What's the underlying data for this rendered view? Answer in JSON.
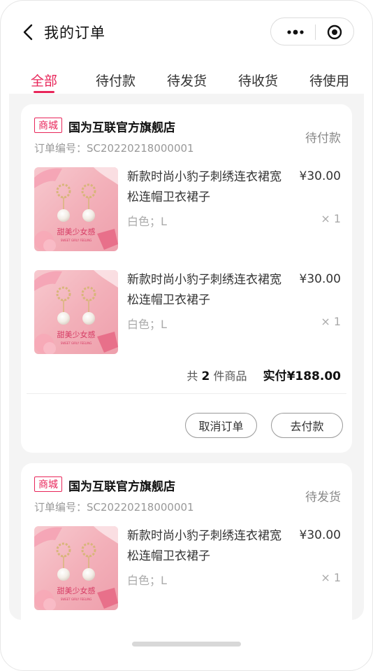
{
  "header": {
    "title": "我的订单"
  },
  "tabs": [
    "全部",
    "待付款",
    "待发货",
    "待收货",
    "待使用"
  ],
  "colors": {
    "accent": "#e8265a"
  },
  "icons": {
    "back": "back-icon",
    "more": "more-icon",
    "close": "target-icon"
  },
  "orders": [
    {
      "tag": "商城",
      "shop": "国为互联官方旗舰店",
      "status": "待付款",
      "order_no": "订单编号：SC20220218000001",
      "items": [
        {
          "name": "新款时尚小豹子刺绣连衣裙宽松连帽卫衣裙子",
          "price": "¥30.00",
          "spec": "白色；L",
          "qty": "× 1",
          "img_text": "甜美少女感",
          "img_sub": "SWEET GIRLY FEELING"
        },
        {
          "name": "新款时尚小豹子刺绣连衣裙宽松连帽卫衣裙子",
          "price": "¥30.00",
          "spec": "白色；L",
          "qty": "× 1",
          "img_text": "甜美少女感",
          "img_sub": "SWEET GIRLY FEELING"
        }
      ],
      "summary_prefix": "共",
      "count": "2",
      "summary_suffix": "件商品",
      "paid_label": "实付",
      "paid_amount": "¥188.00",
      "buttons": [
        "取消订单",
        "去付款"
      ]
    },
    {
      "tag": "商城",
      "shop": "国为互联官方旗舰店",
      "status": "待发货",
      "order_no": "订单编号：SC20220218000001",
      "items": [
        {
          "name": "新款时尚小豹子刺绣连衣裙宽松连帽卫衣裙子",
          "price": "¥30.00",
          "spec": "白色；L",
          "qty": "× 1",
          "img_text": "甜美少女感",
          "img_sub": "SWEET GIRLY FEELING"
        }
      ]
    }
  ]
}
